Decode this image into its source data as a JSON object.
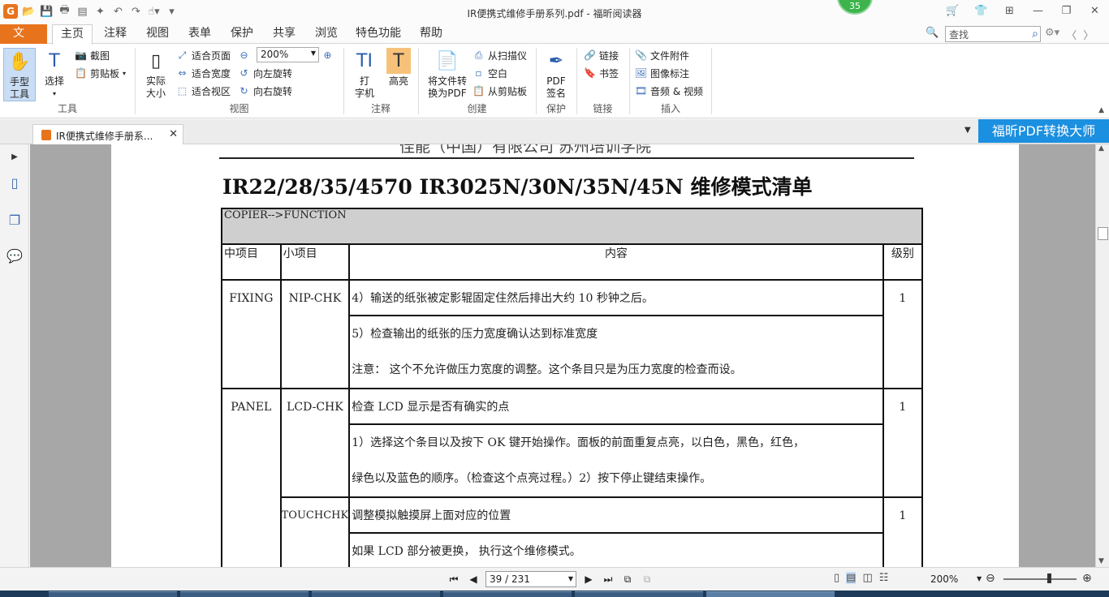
{
  "window": {
    "title": "IR便携式维修手册系列.pdf - 福昕阅读器",
    "badge": "35"
  },
  "menu": {
    "file": "文件",
    "tabs": [
      "主页",
      "注释",
      "视图",
      "表单",
      "保护",
      "共享",
      "浏览",
      "特色功能",
      "帮助"
    ],
    "search_placeholder": "查找"
  },
  "ribbon": {
    "tools": {
      "hand": "手型\n工具",
      "hand_l1": "手型",
      "hand_l2": "工具",
      "select": "选择",
      "screenshot": "截图",
      "clipboard": "剪贴板",
      "label": "工具"
    },
    "view": {
      "actual_l1": "实际",
      "actual_l2": "大小",
      "fit_page": "适合页面",
      "fit_width": "适合宽度",
      "fit_visible": "适合视区",
      "zoom": "200%",
      "rotate_left": "向左旋转",
      "rotate_right": "向右旋转",
      "label": "视图"
    },
    "comment": {
      "typewriter_l1": "打",
      "typewriter_l2": "字机",
      "highlight": "高亮",
      "label": "注释"
    },
    "create": {
      "convert_l1": "将文件转",
      "convert_l2": "换为PDF",
      "from_scanner": "从扫描仪",
      "blank": "空白",
      "from_clipboard": "从剪贴板",
      "label": "创建"
    },
    "protect": {
      "sign_l1": "PDF",
      "sign_l2": "签名",
      "label": "保护"
    },
    "links": {
      "link": "链接",
      "bookmark": "书签",
      "label": "链接"
    },
    "insert": {
      "attachment": "文件附件",
      "image": "图像标注",
      "av": "音频 & 视频",
      "label": "插入"
    }
  },
  "doctab": {
    "title": "IR便携式维修手册系..."
  },
  "promo": "福昕PDF转换大师",
  "document": {
    "header": "佳能（中国）有限公司 苏州培训学院",
    "title": "IR22/28/35/4570   IR3025N/30N/35N/45N 维修模式清单",
    "table": {
      "section": "COPIER-->FUNCTION",
      "columns": [
        "中项目",
        "小项目",
        "内容",
        "级别"
      ],
      "rows": [
        {
          "major": "FIXING",
          "minor": "NIP-CHK",
          "level": "1",
          "lines": [
            "4）输送的纸张被定影辊固定住然后排出大约 10 秒钟之后。",
            "5）检查输出的纸张的压力宽度确认达到标准宽度",
            "注意：  这个不允许做压力宽度的调整。这个条目只是为压力宽度的检查而设。"
          ]
        },
        {
          "major": "PANEL",
          "minor": "LCD-CHK",
          "level": "1",
          "lines": [
            "检查 LCD 显示是否有确实的点",
            "1）选择这个条目以及按下 OK 键开始操作。面板的前面重复点亮，以白色，黑色，红色，",
            "绿色以及蓝色的顺序。（检查这个点亮过程。）2）按下停止键结束操作。"
          ]
        },
        {
          "major": "",
          "minor": "TOUCHCHK",
          "level": "1",
          "lines": [
            "调整模拟触摸屏上面对应的位置",
            "如果 LCD 部分被更换， 执行这个维修模式。"
          ]
        }
      ]
    }
  },
  "status": {
    "page": "39 / 231",
    "zoom": "200%"
  }
}
